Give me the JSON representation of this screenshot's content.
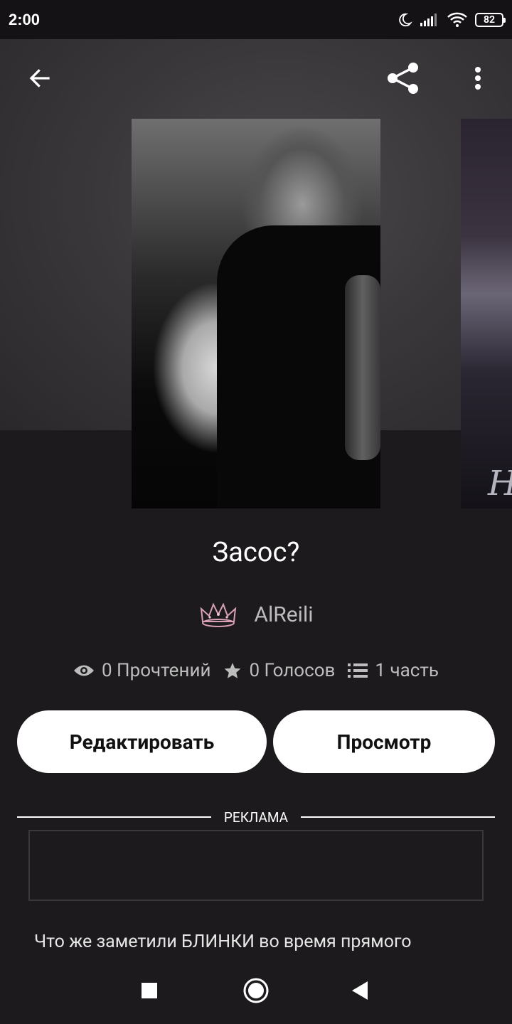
{
  "status_bar": {
    "time": "2:00",
    "battery": "82",
    "icons": [
      "moon-icon",
      "signal-icon",
      "wifi-icon",
      "battery-icon"
    ]
  },
  "toolbar": {
    "icons": [
      "back-arrow-icon",
      "share-icon",
      "more-vert-icon"
    ]
  },
  "story": {
    "title": "Засос?",
    "author": "AlReili",
    "reads": "0 Прочтений",
    "votes": "0 Голосов",
    "parts": "1 часть",
    "description": "Что же заметили БЛИНКИ во время прямого"
  },
  "actions": {
    "edit_label": "Редактировать",
    "view_label": "Просмотр"
  },
  "ad": {
    "label": "РЕКЛАМА"
  },
  "next_cover": {
    "glyph": "H"
  },
  "nav": {
    "icons": [
      "recents-square-icon",
      "home-circle-icon",
      "back-triangle-icon"
    ]
  },
  "colors": {
    "background": "#1c1a1c",
    "button": "#ffffff",
    "secondary_text": "#bdbdbd"
  }
}
